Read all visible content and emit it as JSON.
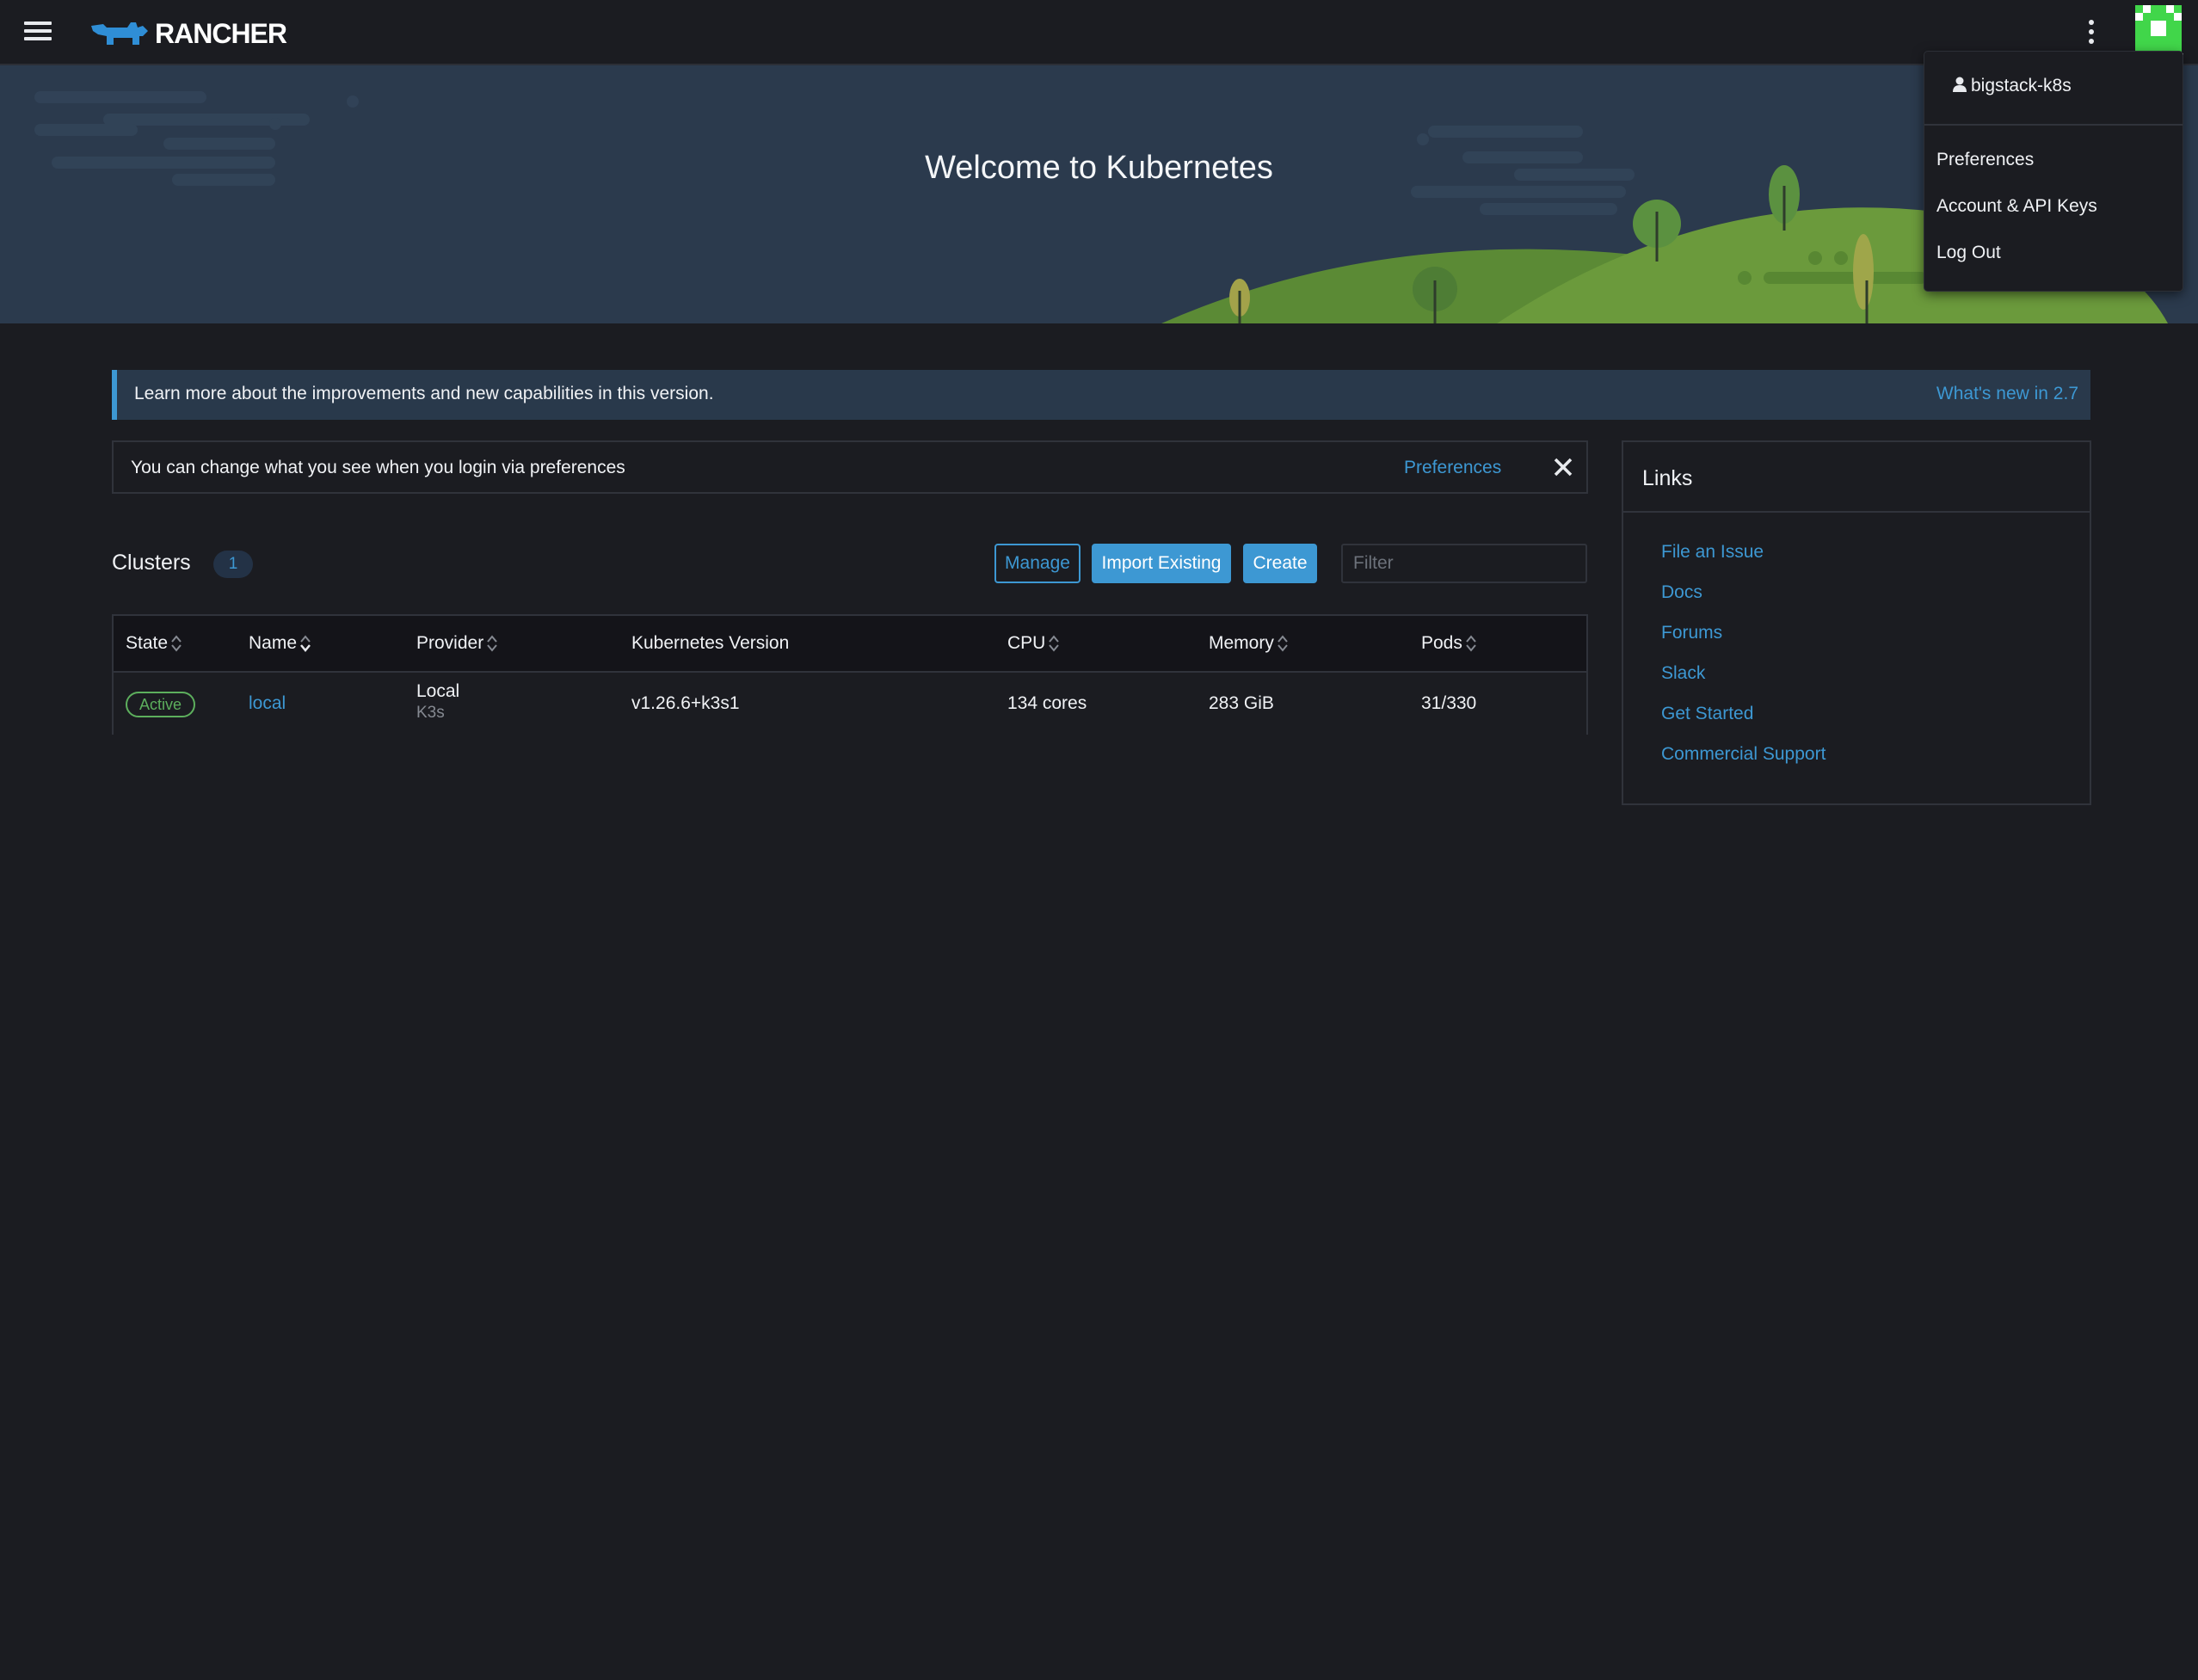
{
  "header": {
    "logo_text": "RANCHER",
    "menu_icon": "hamburger-icon",
    "kebab_icon": "more-vertical-icon",
    "avatar_icon": "user-avatar-icon"
  },
  "banner": {
    "title": "Welcome to Kubernetes"
  },
  "notice": {
    "text": "Learn more about the improvements and new capabilities in this version.",
    "link": "What's new in 2.7"
  },
  "prefbar": {
    "text": "You can change what you see when you login via preferences",
    "link": "Preferences",
    "close_icon": "close-icon"
  },
  "clusters": {
    "title": "Clusters",
    "count": "1",
    "buttons": {
      "manage": "Manage",
      "import": "Import Existing",
      "create": "Create"
    },
    "filter_placeholder": "Filter",
    "columns": [
      "State",
      "Name",
      "Provider",
      "Kubernetes Version",
      "CPU",
      "Memory",
      "Pods"
    ],
    "rows": [
      {
        "state": "Active",
        "name": "local",
        "provider": "Local",
        "provider_sub": "K3s",
        "version": "v1.26.6+k3s1",
        "cpu": "134 cores",
        "memory": "283 GiB",
        "pods": "31/330"
      }
    ]
  },
  "links": {
    "title": "Links",
    "items": [
      "File an Issue",
      "Docs",
      "Forums",
      "Slack",
      "Get Started",
      "Commercial Support"
    ]
  },
  "user_menu": {
    "username": "bigstack-k8s",
    "items": [
      "Preferences",
      "Account & API Keys",
      "Log Out"
    ]
  },
  "colors": {
    "background": "#1b1c21",
    "accent": "#3d98d3",
    "banner": "#2b3a4d",
    "active": "#5daf5d",
    "hill": "#6b9a3c",
    "avatar": "#41d64a"
  }
}
